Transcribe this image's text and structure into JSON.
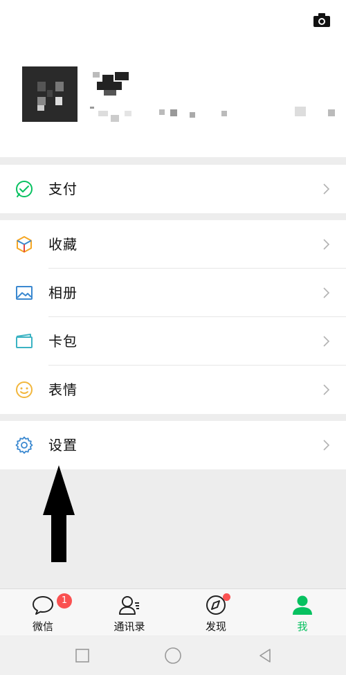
{
  "header": {
    "camera_icon": "camera-icon",
    "avatar": "pixelated-avatar",
    "nickname": "",
    "account_id": ""
  },
  "menu": {
    "group1": [
      {
        "label": "支付",
        "icon": "pay-icon",
        "color": "#07c160"
      }
    ],
    "group2": [
      {
        "label": "收藏",
        "icon": "favorites-cube-icon",
        "color": "#f5a623"
      },
      {
        "label": "相册",
        "icon": "album-icon",
        "color": "#3a88d0"
      },
      {
        "label": "卡包",
        "icon": "card-wallet-icon",
        "color": "#3bb3c3"
      },
      {
        "label": "表情",
        "icon": "emoji-icon",
        "color": "#f2b63c"
      }
    ],
    "group3": [
      {
        "label": "设置",
        "icon": "settings-gear-icon",
        "color": "#3a88d0"
      }
    ]
  },
  "annotation": {
    "arrow": "up-arrow-pointing-to-settings"
  },
  "tabbar": {
    "tabs": [
      {
        "label": "微信",
        "badge": "1",
        "icon": "chat-bubble-icon"
      },
      {
        "label": "通讯录",
        "icon": "contacts-icon"
      },
      {
        "label": "发现",
        "icon": "compass-icon",
        "dot": true
      },
      {
        "label": "我",
        "icon": "person-icon",
        "active": true
      }
    ],
    "active_color": "#07c160"
  },
  "system_nav": {
    "buttons": [
      "recent-apps-square",
      "home-circle",
      "back-triangle"
    ]
  }
}
